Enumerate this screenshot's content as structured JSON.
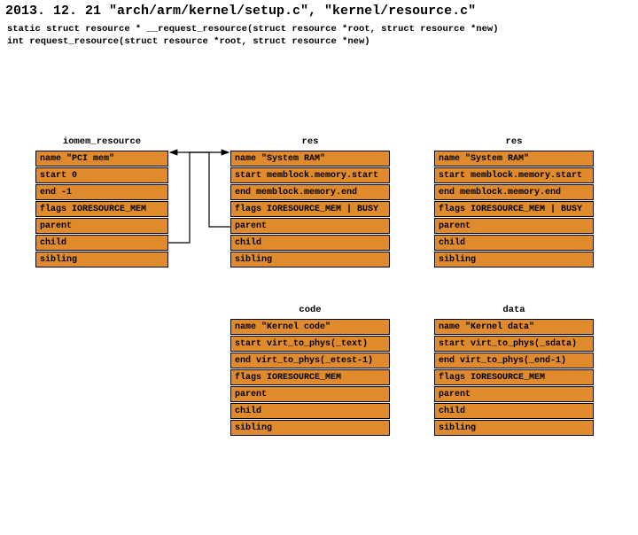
{
  "title": "2013. 12. 21  \"arch/arm/kernel/setup.c\",  \"kernel/resource.c\"",
  "sig1": "static struct resource * __request_resource(struct resource *root, struct resource *new)",
  "sig2": "int request_resource(struct resource *root, struct resource *new)",
  "structs": {
    "iomem": {
      "title": "iomem_resource",
      "rows": [
        "name \"PCI mem\"",
        "start 0",
        "end -1",
        "flags IORESOURCE_MEM",
        "parent",
        "child",
        "sibling"
      ]
    },
    "res1": {
      "title": "res",
      "rows": [
        "name \"System RAM\"",
        "start memblock.memory.start",
        "end memblock.memory.end",
        "flags IORESOURCE_MEM | BUSY",
        "parent",
        "child",
        "sibling"
      ]
    },
    "res2": {
      "title": "res",
      "rows": [
        "name \"System RAM\"",
        "start memblock.memory.start",
        "end memblock.memory.end",
        "flags IORESOURCE_MEM | BUSY",
        "parent",
        "child",
        "sibling"
      ]
    },
    "code": {
      "title": "code",
      "rows": [
        "name \"Kernel code\"",
        "start  virt_to_phys(_text)",
        "end  virt_to_phys(_etest-1)",
        "flags IORESOURCE_MEM",
        "parent",
        "child",
        "sibling"
      ]
    },
    "data": {
      "title": "data",
      "rows": [
        "name \"Kernel data\"",
        "start virt_to_phys(_sdata)",
        "end virt_to_phys(_end-1)",
        "flags IORESOURCE_MEM",
        "parent",
        "child",
        "sibling"
      ]
    }
  }
}
